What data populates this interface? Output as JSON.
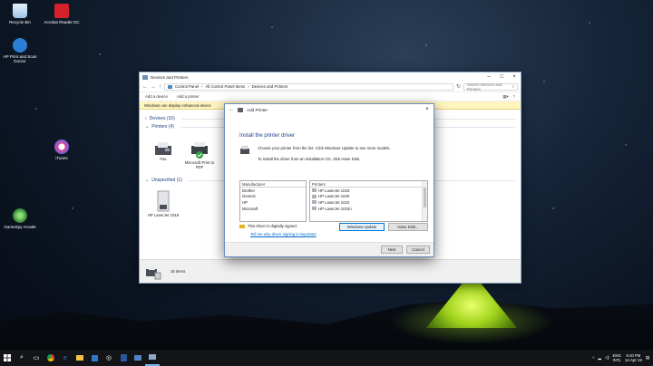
{
  "desktop": {
    "icons": [
      {
        "label": "Recycle Bin",
        "color": "#cfe3f7"
      },
      {
        "label": "Acrobat Reader DC",
        "color": "#d4202a"
      },
      {
        "label": "HP Print and Scan Doctor",
        "color": "#2a7ed3"
      },
      {
        "label": "iTunes",
        "color": "#e9e9ee"
      },
      {
        "label": "GameSpy Arcade",
        "color": "#3c9b3c"
      }
    ]
  },
  "window": {
    "title": "Devices and Printers",
    "breadcrumb": [
      "Control Panel",
      "All Control Panel Items",
      "Devices and Printers"
    ],
    "search_placeholder": "Search Devices and Printers",
    "commands": [
      "Add a device",
      "Add a printer"
    ],
    "info_bar": "Windows can display enhanced device",
    "groups": {
      "devices": "Devices (10)",
      "printers": "Printers (4)",
      "unspecified": "Unspecified (1)"
    },
    "printers": [
      "Fax",
      "Microsoft Print to PDF"
    ],
    "unspecified_devices": [
      "HP LaserJet 1018"
    ],
    "status": "15 items"
  },
  "dialog": {
    "title": "Add Printer",
    "heading": "Install the printer driver",
    "desc1": "Choose your printer from the list. Click Windows Update to see more models.",
    "desc2": "To install the driver from an installation CD, click Have Disk.",
    "manufacturer_header": "Manufacturer",
    "manufacturers": [
      "Brother",
      "Generic",
      "HP",
      "Microsoft"
    ],
    "printers_header": "Printers",
    "printers": [
      "HP LaserJet 1018",
      "HP LaserJet 1020",
      "HP LaserJet 1022",
      "HP LaserJet 1022n"
    ],
    "signed_text": "This driver is digitally signed.",
    "signing_link": "Tell me why driver signing is important",
    "windows_update": "Windows Update",
    "have_disk": "Have Disk...",
    "next": "Next",
    "cancel": "Cancel"
  },
  "taskbar": {
    "lang": "ENG",
    "region": "INTL",
    "time": "9:40 PM",
    "date": "14-Apr-19"
  }
}
